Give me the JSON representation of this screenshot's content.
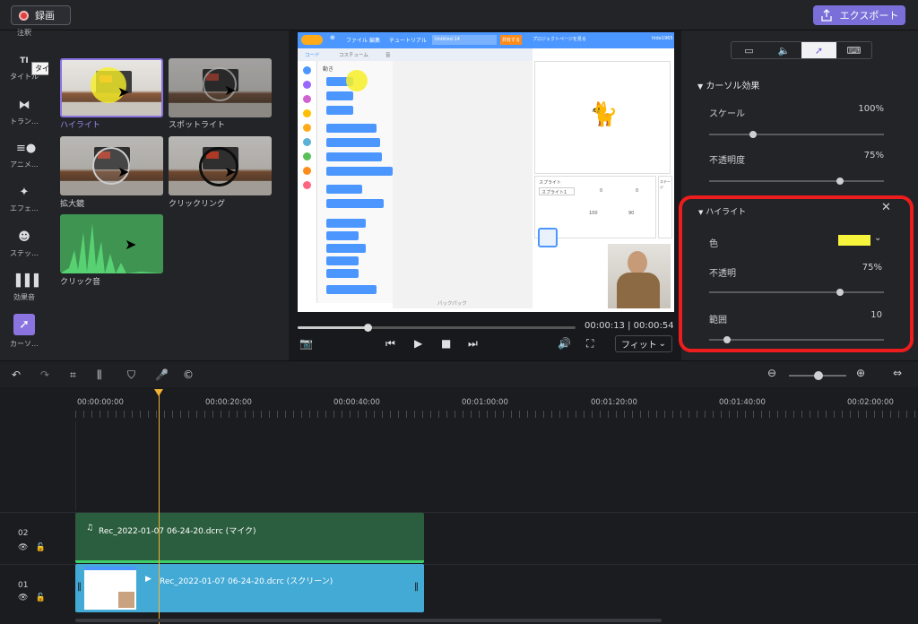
{
  "topbar": {
    "record_label": "録画",
    "export_label": "エクスポート"
  },
  "sidebar": {
    "items": [
      {
        "label": "注釈",
        "icon": "annotation-icon"
      },
      {
        "label": "タイトル",
        "icon": "title-icon"
      },
      {
        "label": "トラン…",
        "icon": "transition-icon"
      },
      {
        "label": "アニメ…",
        "icon": "animation-icon"
      },
      {
        "label": "エフェ…",
        "icon": "effect-icon"
      },
      {
        "label": "ステッ…",
        "icon": "sticker-icon"
      },
      {
        "label": "効果音",
        "icon": "sound-effect-icon"
      },
      {
        "label": "カーソ…",
        "icon": "cursor-icon"
      }
    ],
    "title_icon_text": "TI",
    "tooltip": "タイトル"
  },
  "assets": {
    "items": [
      {
        "label": "ハイライト"
      },
      {
        "label": "スポットライト"
      },
      {
        "label": "拡大鏡"
      },
      {
        "label": "クリックリング"
      },
      {
        "label": "クリック音"
      }
    ]
  },
  "preview": {
    "timecode": "00:00:13 | 00:00:54",
    "fit_label": "フィット",
    "scratch": {
      "tabs": [
        "コード",
        "コスチューム",
        "音"
      ],
      "menu": [
        "ファイル",
        "編集",
        "チュートリアル"
      ],
      "project_title": "Untitled-14",
      "share_button": "共有する",
      "project_page": "プロジェクトページを見る",
      "user": "hide1965",
      "category_title": "動き",
      "sprite_label": "スプライト",
      "sprite_name": "スプライト1",
      "x_value": "0",
      "y_value": "0",
      "size_value": "100",
      "direction_value": "90",
      "backpack": "バックパック",
      "stage_label": "ステージ"
    }
  },
  "props": {
    "cursor_effect_title": "カーソル効果",
    "scale_label": "スケール",
    "scale_value": "100%",
    "scale_level": 0.25,
    "opacity_label": "不透明度",
    "opacity_value": "75%",
    "opacity_level": 0.75,
    "highlight_title": "ハイライト",
    "color_label": "色",
    "highlight_color": "#f7f53b",
    "hl_opacity_label": "不透明",
    "hl_opacity_value": "75%",
    "hl_opacity_level": 0.75,
    "range_label": "範囲",
    "range_value": "10",
    "range_level": 0.1
  },
  "timeline": {
    "ticks": [
      "00:00:00:00",
      "00:00:20:00",
      "00:00:40:00",
      "00:01:00:00",
      "00:01:20:00",
      "00:01:40:00",
      "00:02:00:00"
    ],
    "tracks": [
      {
        "num": "02",
        "clip_title": "Rec_2022-01-07 06-24-20.dcrc (マイク)"
      },
      {
        "num": "01",
        "clip_title": "Rec_2022-01-07 06-24-20.dcrc (スクリーン)"
      }
    ]
  },
  "colors": {
    "accent": "#7a6fd8",
    "playhead": "#f2b233",
    "audio_clip": "#2b5e3e",
    "video_clip": "#43aad6",
    "highlight_box": "#ee1d1d"
  }
}
